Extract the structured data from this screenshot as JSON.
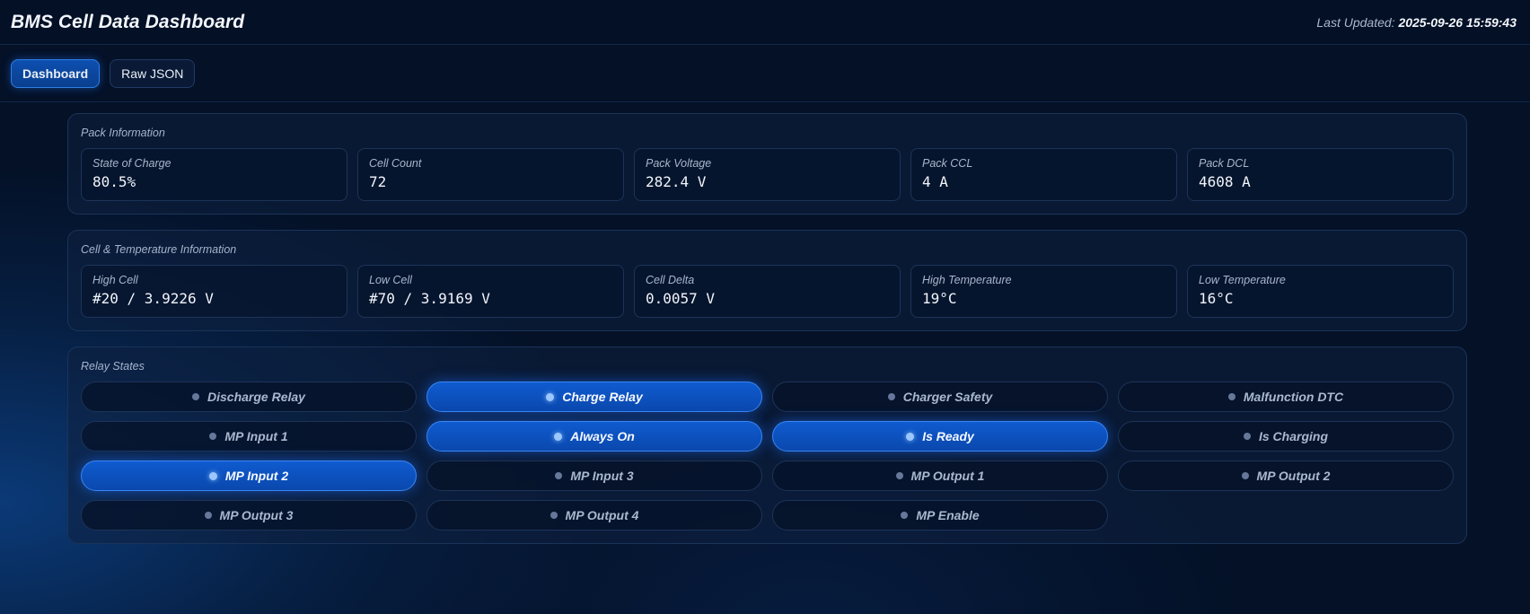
{
  "header": {
    "title": "BMS Cell Data Dashboard",
    "updated_label": "Last Updated:",
    "updated_value": "2025-09-26 15:59:43"
  },
  "tabs": [
    {
      "label": "Dashboard",
      "active": true
    },
    {
      "label": "Raw JSON",
      "active": false
    }
  ],
  "pack": {
    "title": "Pack Information",
    "stats": [
      {
        "label": "State of Charge",
        "value": "80.5%"
      },
      {
        "label": "Cell Count",
        "value": "72"
      },
      {
        "label": "Pack Voltage",
        "value": "282.4 V"
      },
      {
        "label": "Pack CCL",
        "value": "4 A"
      },
      {
        "label": "Pack DCL",
        "value": "4608 A"
      }
    ]
  },
  "cells": {
    "title": "Cell & Temperature Information",
    "stats": [
      {
        "label": "High Cell",
        "value": "#20 / 3.9226 V"
      },
      {
        "label": "Low Cell",
        "value": "#70 / 3.9169 V"
      },
      {
        "label": "Cell Delta",
        "value": "0.0057 V"
      },
      {
        "label": "High Temperature",
        "value": "19°C"
      },
      {
        "label": "Low Temperature",
        "value": "16°C"
      }
    ]
  },
  "relays": {
    "title": "Relay States",
    "items": [
      {
        "label": "Discharge Relay",
        "on": false
      },
      {
        "label": "Charge Relay",
        "on": true
      },
      {
        "label": "Charger Safety",
        "on": false
      },
      {
        "label": "Malfunction DTC",
        "on": false
      },
      {
        "label": "MP Input 1",
        "on": false
      },
      {
        "label": "Always On",
        "on": true
      },
      {
        "label": "Is Ready",
        "on": true
      },
      {
        "label": "Is Charging",
        "on": false
      },
      {
        "label": "MP Input 2",
        "on": true
      },
      {
        "label": "MP Input 3",
        "on": false
      },
      {
        "label": "MP Output 1",
        "on": false
      },
      {
        "label": "MP Output 2",
        "on": false
      },
      {
        "label": "MP Output 3",
        "on": false
      },
      {
        "label": "MP Output 4",
        "on": false
      },
      {
        "label": "MP Enable",
        "on": false
      }
    ]
  }
}
